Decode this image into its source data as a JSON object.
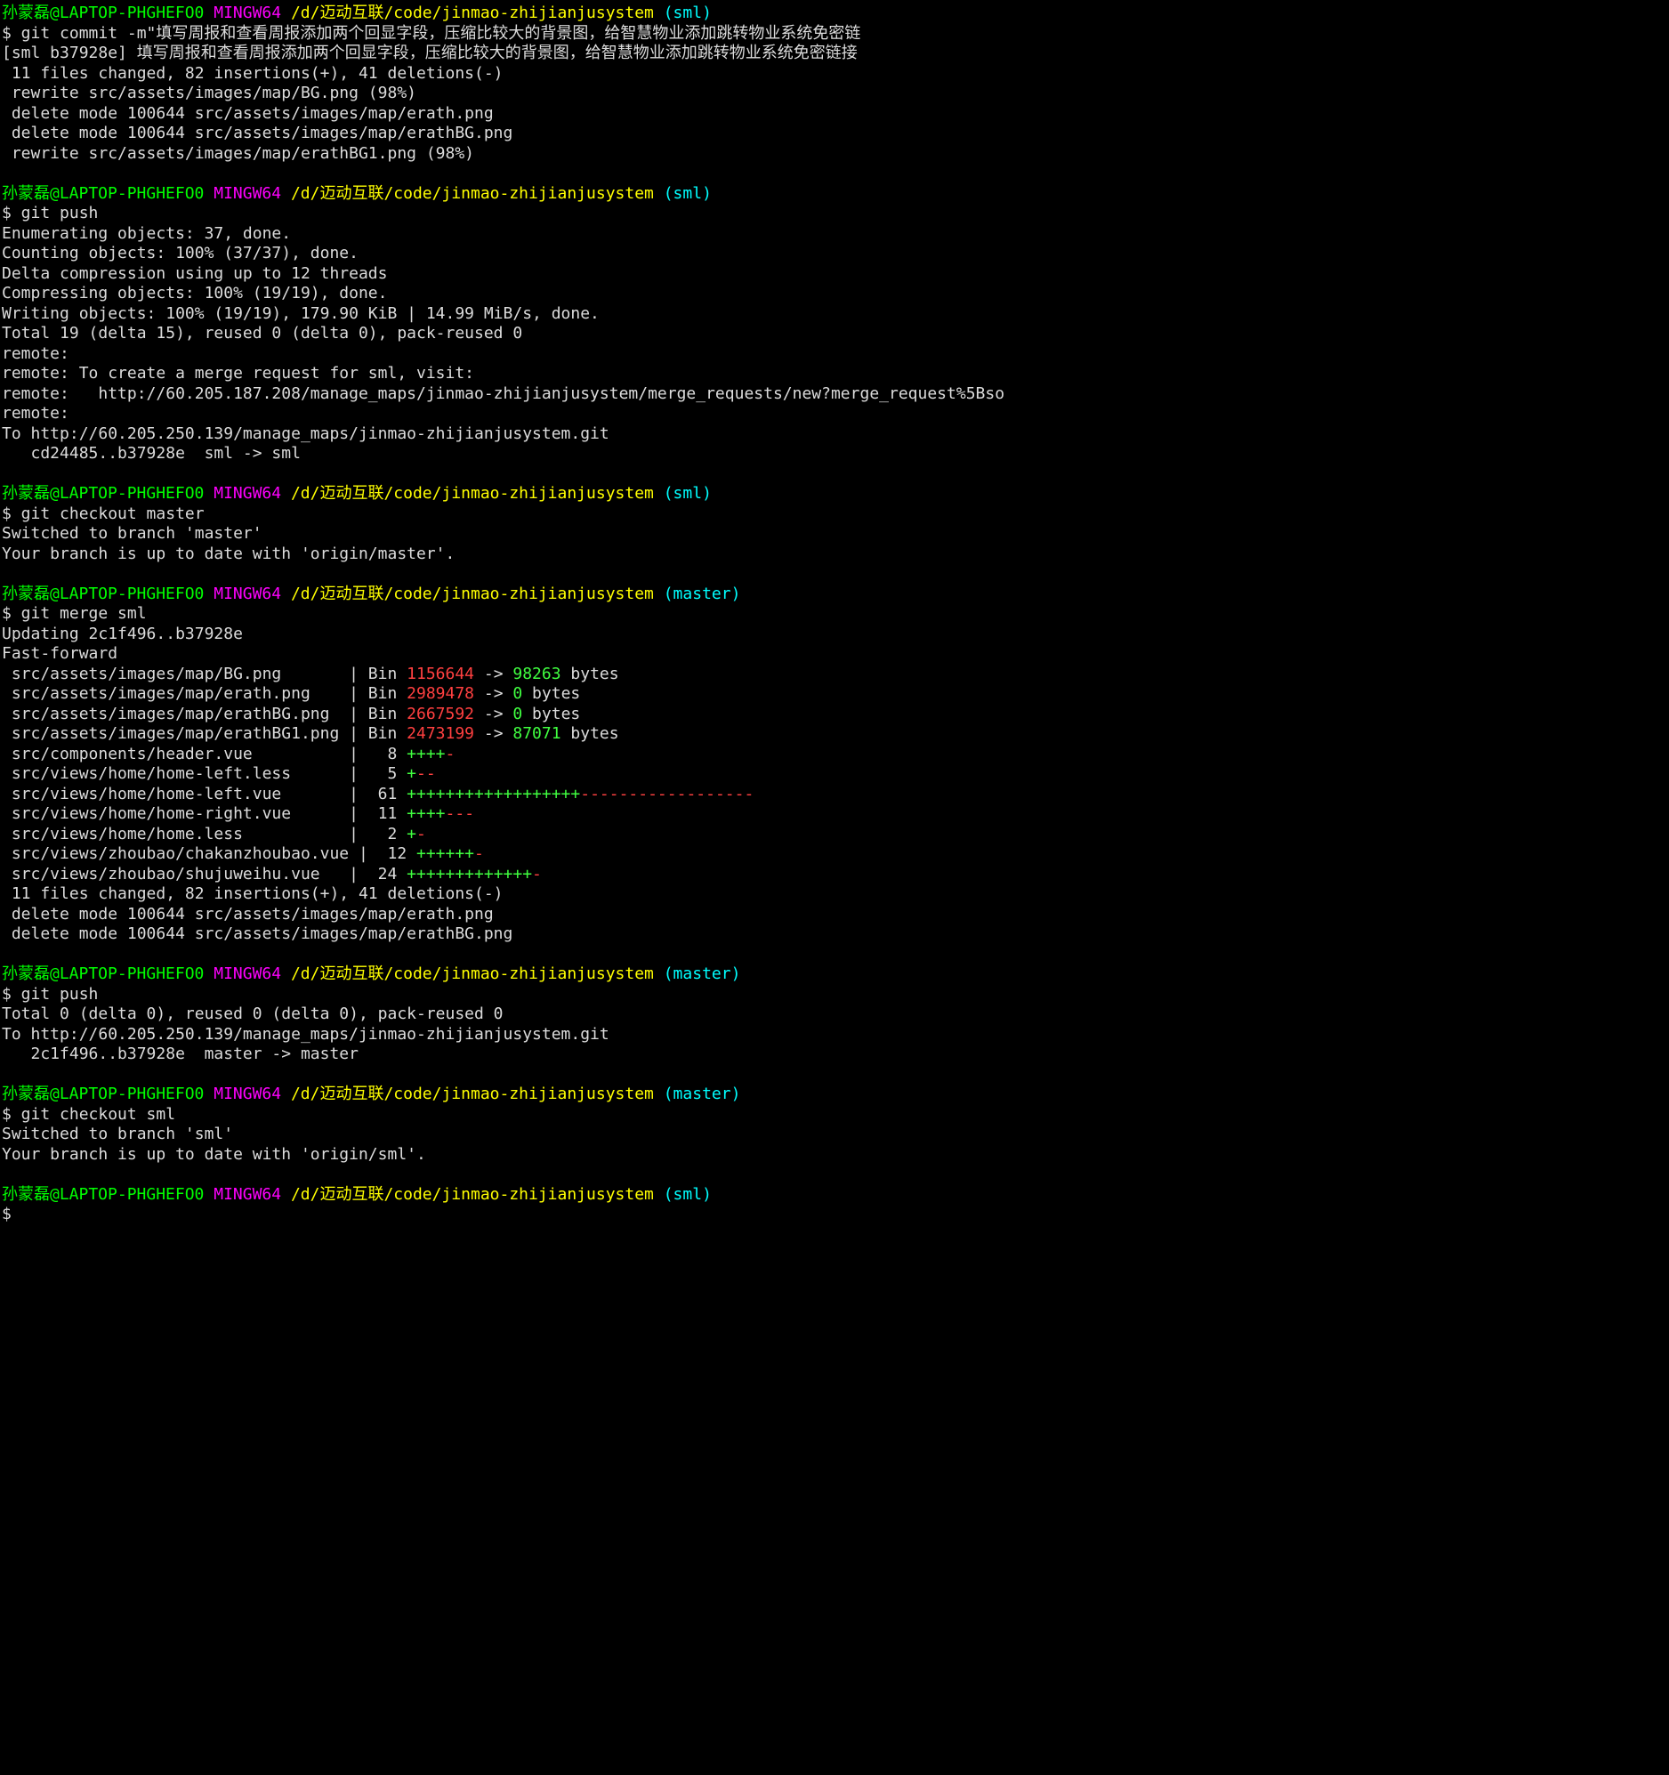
{
  "lines": [
    {
      "segments": [
        {
          "cls": "c-green",
          "text": "孙蒙磊@LAPTOP-PHGHEFO0 "
        },
        {
          "cls": "c-magenta",
          "text": "MINGW64 "
        },
        {
          "cls": "c-yellow",
          "text": "/d/迈动互联/code/jinmao-zhijianjusystem "
        },
        {
          "cls": "c-cyan",
          "text": "(sml)"
        }
      ]
    },
    {
      "segments": [
        {
          "cls": "c-white",
          "text": "$ git commit -m\"填写周报和查看周报添加两个回显字段，压缩比较大的背景图，给智慧物业添加跳转物业系统免密链"
        }
      ]
    },
    {
      "segments": [
        {
          "cls": "c-white",
          "text": "[sml b37928e] 填写周报和查看周报添加两个回显字段，压缩比较大的背景图，给智慧物业添加跳转物业系统免密链接"
        }
      ]
    },
    {
      "segments": [
        {
          "cls": "c-white",
          "text": " 11 files changed, 82 insertions(+), 41 deletions(-)"
        }
      ]
    },
    {
      "segments": [
        {
          "cls": "c-white",
          "text": " rewrite src/assets/images/map/BG.png (98%)"
        }
      ]
    },
    {
      "segments": [
        {
          "cls": "c-white",
          "text": " delete mode 100644 src/assets/images/map/erath.png"
        }
      ]
    },
    {
      "segments": [
        {
          "cls": "c-white",
          "text": " delete mode 100644 src/assets/images/map/erathBG.png"
        }
      ]
    },
    {
      "segments": [
        {
          "cls": "c-white",
          "text": " rewrite src/assets/images/map/erathBG1.png (98%)"
        }
      ]
    },
    {
      "segments": [
        {
          "cls": "c-white",
          "text": ""
        }
      ]
    },
    {
      "segments": [
        {
          "cls": "c-green",
          "text": "孙蒙磊@LAPTOP-PHGHEFO0 "
        },
        {
          "cls": "c-magenta",
          "text": "MINGW64 "
        },
        {
          "cls": "c-yellow",
          "text": "/d/迈动互联/code/jinmao-zhijianjusystem "
        },
        {
          "cls": "c-cyan",
          "text": "(sml)"
        }
      ]
    },
    {
      "segments": [
        {
          "cls": "c-white",
          "text": "$ git push"
        }
      ]
    },
    {
      "segments": [
        {
          "cls": "c-white",
          "text": "Enumerating objects: 37, done."
        }
      ]
    },
    {
      "segments": [
        {
          "cls": "c-white",
          "text": "Counting objects: 100% (37/37), done."
        }
      ]
    },
    {
      "segments": [
        {
          "cls": "c-white",
          "text": "Delta compression using up to 12 threads"
        }
      ]
    },
    {
      "segments": [
        {
          "cls": "c-white",
          "text": "Compressing objects: 100% (19/19), done."
        }
      ]
    },
    {
      "segments": [
        {
          "cls": "c-white",
          "text": "Writing objects: 100% (19/19), 179.90 KiB | 14.99 MiB/s, done."
        }
      ]
    },
    {
      "segments": [
        {
          "cls": "c-white",
          "text": "Total 19 (delta 15), reused 0 (delta 0), pack-reused 0"
        }
      ]
    },
    {
      "segments": [
        {
          "cls": "c-white",
          "text": "remote:"
        }
      ]
    },
    {
      "segments": [
        {
          "cls": "c-white",
          "text": "remote: To create a merge request for sml, visit:"
        }
      ]
    },
    {
      "segments": [
        {
          "cls": "c-white",
          "text": "remote:   http://60.205.187.208/manage_maps/jinmao-zhijianjusystem/merge_requests/new?merge_request%5Bso"
        }
      ]
    },
    {
      "segments": [
        {
          "cls": "c-white",
          "text": "remote:"
        }
      ]
    },
    {
      "segments": [
        {
          "cls": "c-white",
          "text": "To http://60.205.250.139/manage_maps/jinmao-zhijianjusystem.git"
        }
      ]
    },
    {
      "segments": [
        {
          "cls": "c-white",
          "text": "   cd24485..b37928e  sml -> sml"
        }
      ]
    },
    {
      "segments": [
        {
          "cls": "c-white",
          "text": ""
        }
      ]
    },
    {
      "segments": [
        {
          "cls": "c-green",
          "text": "孙蒙磊@LAPTOP-PHGHEFO0 "
        },
        {
          "cls": "c-magenta",
          "text": "MINGW64 "
        },
        {
          "cls": "c-yellow",
          "text": "/d/迈动互联/code/jinmao-zhijianjusystem "
        },
        {
          "cls": "c-cyan",
          "text": "(sml)"
        }
      ]
    },
    {
      "segments": [
        {
          "cls": "c-white",
          "text": "$ git checkout master"
        }
      ]
    },
    {
      "segments": [
        {
          "cls": "c-white",
          "text": "Switched to branch 'master'"
        }
      ]
    },
    {
      "segments": [
        {
          "cls": "c-white",
          "text": "Your branch is up to date with 'origin/master'."
        }
      ]
    },
    {
      "segments": [
        {
          "cls": "c-white",
          "text": ""
        }
      ]
    },
    {
      "segments": [
        {
          "cls": "c-green",
          "text": "孙蒙磊@LAPTOP-PHGHEFO0 "
        },
        {
          "cls": "c-magenta",
          "text": "MINGW64 "
        },
        {
          "cls": "c-yellow",
          "text": "/d/迈动互联/code/jinmao-zhijianjusystem "
        },
        {
          "cls": "c-cyan",
          "text": "(master)"
        }
      ]
    },
    {
      "segments": [
        {
          "cls": "c-white",
          "text": "$ git merge sml"
        }
      ]
    },
    {
      "segments": [
        {
          "cls": "c-white",
          "text": "Updating 2c1f496..b37928e"
        }
      ]
    },
    {
      "segments": [
        {
          "cls": "c-white",
          "text": "Fast-forward"
        }
      ]
    },
    {
      "segments": [
        {
          "cls": "c-white",
          "text": " src/assets/images/map/BG.png       | Bin "
        },
        {
          "cls": "c-red",
          "text": "1156644"
        },
        {
          "cls": "c-white",
          "text": " -> "
        },
        {
          "cls": "c-lime",
          "text": "98263"
        },
        {
          "cls": "c-white",
          "text": " bytes"
        }
      ]
    },
    {
      "segments": [
        {
          "cls": "c-white",
          "text": " src/assets/images/map/erath.png    | Bin "
        },
        {
          "cls": "c-red",
          "text": "2989478"
        },
        {
          "cls": "c-white",
          "text": " -> "
        },
        {
          "cls": "c-lime",
          "text": "0"
        },
        {
          "cls": "c-white",
          "text": " bytes"
        }
      ]
    },
    {
      "segments": [
        {
          "cls": "c-white",
          "text": " src/assets/images/map/erathBG.png  | Bin "
        },
        {
          "cls": "c-red",
          "text": "2667592"
        },
        {
          "cls": "c-white",
          "text": " -> "
        },
        {
          "cls": "c-lime",
          "text": "0"
        },
        {
          "cls": "c-white",
          "text": " bytes"
        }
      ]
    },
    {
      "segments": [
        {
          "cls": "c-white",
          "text": " src/assets/images/map/erathBG1.png | Bin "
        },
        {
          "cls": "c-red",
          "text": "2473199"
        },
        {
          "cls": "c-white",
          "text": " -> "
        },
        {
          "cls": "c-lime",
          "text": "87071"
        },
        {
          "cls": "c-white",
          "text": " bytes"
        }
      ]
    },
    {
      "segments": [
        {
          "cls": "c-white",
          "text": " src/components/header.vue          |   8 "
        },
        {
          "cls": "c-lime",
          "text": "++++"
        },
        {
          "cls": "c-red",
          "text": "-"
        }
      ]
    },
    {
      "segments": [
        {
          "cls": "c-white",
          "text": " src/views/home/home-left.less      |   5 "
        },
        {
          "cls": "c-lime",
          "text": "+"
        },
        {
          "cls": "c-red",
          "text": "--"
        }
      ]
    },
    {
      "segments": [
        {
          "cls": "c-white",
          "text": " src/views/home/home-left.vue       |  61 "
        },
        {
          "cls": "c-lime",
          "text": "++++++++++++++++++"
        },
        {
          "cls": "c-red",
          "text": "------------------"
        }
      ]
    },
    {
      "segments": [
        {
          "cls": "c-white",
          "text": " src/views/home/home-right.vue      |  11 "
        },
        {
          "cls": "c-lime",
          "text": "++++"
        },
        {
          "cls": "c-red",
          "text": "---"
        }
      ]
    },
    {
      "segments": [
        {
          "cls": "c-white",
          "text": " src/views/home/home.less           |   2 "
        },
        {
          "cls": "c-lime",
          "text": "+"
        },
        {
          "cls": "c-red",
          "text": "-"
        }
      ]
    },
    {
      "segments": [
        {
          "cls": "c-white",
          "text": " src/views/zhoubao/chakanzhoubao.vue |  12 "
        },
        {
          "cls": "c-lime",
          "text": "++++++"
        },
        {
          "cls": "c-red",
          "text": "-"
        }
      ]
    },
    {
      "segments": [
        {
          "cls": "c-white",
          "text": " src/views/zhoubao/shujuweihu.vue   |  24 "
        },
        {
          "cls": "c-lime",
          "text": "+++++++++++++"
        },
        {
          "cls": "c-red",
          "text": "-"
        }
      ]
    },
    {
      "segments": [
        {
          "cls": "c-white",
          "text": " 11 files changed, 82 insertions(+), 41 deletions(-)"
        }
      ]
    },
    {
      "segments": [
        {
          "cls": "c-white",
          "text": " delete mode 100644 src/assets/images/map/erath.png"
        }
      ]
    },
    {
      "segments": [
        {
          "cls": "c-white",
          "text": " delete mode 100644 src/assets/images/map/erathBG.png"
        }
      ]
    },
    {
      "segments": [
        {
          "cls": "c-white",
          "text": ""
        }
      ]
    },
    {
      "segments": [
        {
          "cls": "c-green",
          "text": "孙蒙磊@LAPTOP-PHGHEFO0 "
        },
        {
          "cls": "c-magenta",
          "text": "MINGW64 "
        },
        {
          "cls": "c-yellow",
          "text": "/d/迈动互联/code/jinmao-zhijianjusystem "
        },
        {
          "cls": "c-cyan",
          "text": "(master)"
        }
      ]
    },
    {
      "segments": [
        {
          "cls": "c-white",
          "text": "$ git push"
        }
      ]
    },
    {
      "segments": [
        {
          "cls": "c-white",
          "text": "Total 0 (delta 0), reused 0 (delta 0), pack-reused 0"
        }
      ]
    },
    {
      "segments": [
        {
          "cls": "c-white",
          "text": "To http://60.205.250.139/manage_maps/jinmao-zhijianjusystem.git"
        }
      ]
    },
    {
      "segments": [
        {
          "cls": "c-white",
          "text": "   2c1f496..b37928e  master -> master"
        }
      ]
    },
    {
      "segments": [
        {
          "cls": "c-white",
          "text": ""
        }
      ]
    },
    {
      "segments": [
        {
          "cls": "c-green",
          "text": "孙蒙磊@LAPTOP-PHGHEFO0 "
        },
        {
          "cls": "c-magenta",
          "text": "MINGW64 "
        },
        {
          "cls": "c-yellow",
          "text": "/d/迈动互联/code/jinmao-zhijianjusystem "
        },
        {
          "cls": "c-cyan",
          "text": "(master)"
        }
      ]
    },
    {
      "segments": [
        {
          "cls": "c-white",
          "text": "$ git checkout sml"
        }
      ]
    },
    {
      "segments": [
        {
          "cls": "c-white",
          "text": "Switched to branch 'sml'"
        }
      ]
    },
    {
      "segments": [
        {
          "cls": "c-white",
          "text": "Your branch is up to date with 'origin/sml'."
        }
      ]
    },
    {
      "segments": [
        {
          "cls": "c-white",
          "text": ""
        }
      ]
    },
    {
      "segments": [
        {
          "cls": "c-green",
          "text": "孙蒙磊@LAPTOP-PHGHEFO0 "
        },
        {
          "cls": "c-magenta",
          "text": "MINGW64 "
        },
        {
          "cls": "c-yellow",
          "text": "/d/迈动互联/code/jinmao-zhijianjusystem "
        },
        {
          "cls": "c-cyan",
          "text": "(sml)"
        }
      ]
    },
    {
      "segments": [
        {
          "cls": "c-white",
          "text": "$"
        }
      ]
    }
  ]
}
